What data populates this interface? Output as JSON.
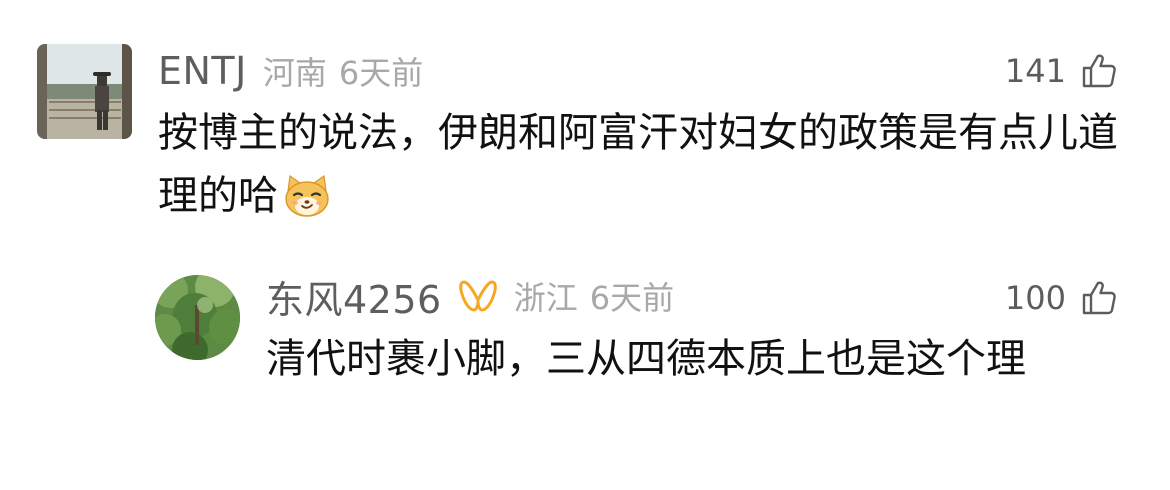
{
  "comments": [
    {
      "username": "ENTJ",
      "location": "河南",
      "time": "6天前",
      "likes": "141",
      "text": "按博主的说法，伊朗和阿富汗对妇女的政策是有点儿道理的哈",
      "avatar": "avatar-man-at-gate",
      "emoji": "smirk-cat-emoji"
    },
    {
      "username": "东风4256",
      "badge": "vip-badge-icon",
      "location": "浙江",
      "time": "6天前",
      "likes": "100",
      "text": "清代时裹小脚，三从四德本质上也是这个理",
      "avatar": "avatar-green-trees"
    }
  ],
  "colors": {
    "username": "#5e5e5e",
    "meta": "#a8a8a8",
    "body_text": "#111111",
    "vip_orange": "#f5a623"
  }
}
